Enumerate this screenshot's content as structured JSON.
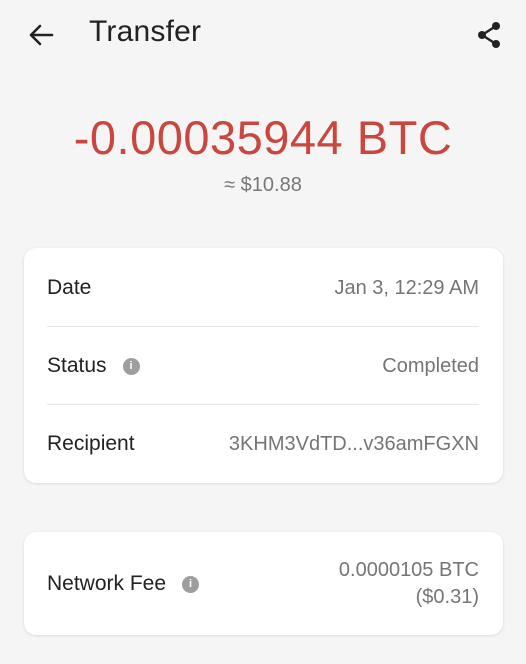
{
  "header": {
    "title": "Transfer"
  },
  "amount": {
    "crypto": "-0.00035944 BTC",
    "fiat": "≈ $10.88",
    "color": "#c9473e"
  },
  "details": {
    "date_label": "Date",
    "date_value": "Jan 3, 12:29 AM",
    "status_label": "Status",
    "status_value": "Completed",
    "recipient_label": "Recipient",
    "recipient_value": "3KHM3VdTD...v36amFGXN"
  },
  "fee": {
    "label": "Network Fee",
    "btc": "0.0000105 BTC",
    "fiat": "($0.31)"
  },
  "icons": {
    "back": "arrow-left-icon",
    "share": "share-icon",
    "info": "info-icon"
  }
}
